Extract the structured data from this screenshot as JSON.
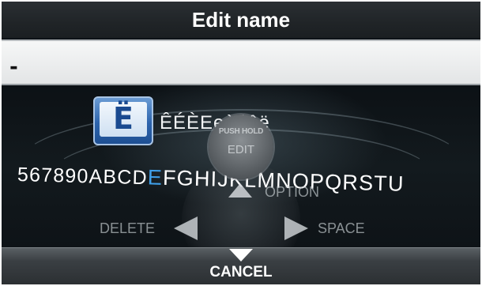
{
  "screen": {
    "title": "Edit name",
    "input_value": "-"
  },
  "keyboard": {
    "selected_char": "Ë",
    "variants": "ÊÉÈEeèéêë",
    "row_before": "567890ABCD",
    "row_highlight": "E",
    "row_after": "FGHIJKLMNOPQRSTU"
  },
  "controls": {
    "option_label": "OPTION",
    "delete_label": "DELETE",
    "space_label": "SPACE",
    "knob_top": "PUSH HOLD",
    "knob_bottom": "EDIT",
    "cancel_label": "CANCEL"
  },
  "colors": {
    "highlight": "#3fa0ea",
    "selected_tile": "#2d64ad"
  }
}
